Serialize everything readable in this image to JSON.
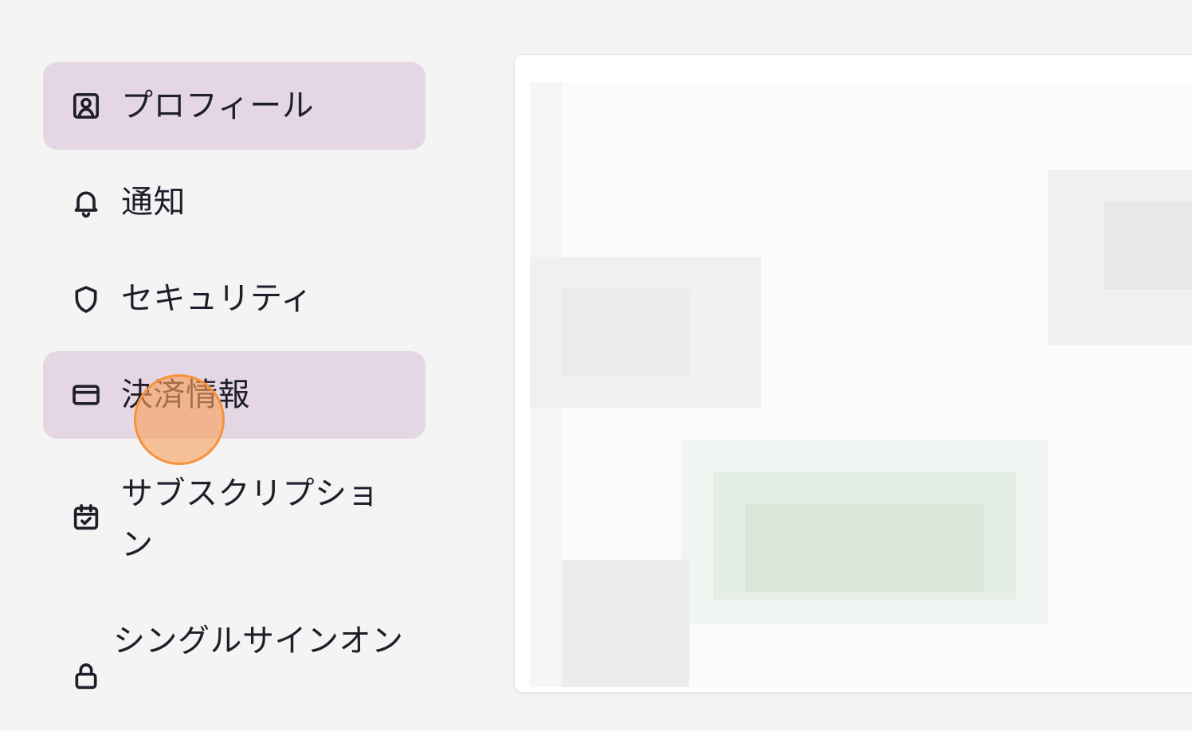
{
  "sidebar": {
    "items": [
      {
        "label": "プロフィール",
        "icon": "profile-icon",
        "active": true
      },
      {
        "label": "通知",
        "icon": "bell-icon",
        "active": false
      },
      {
        "label": "セキュリティ",
        "icon": "shield-icon",
        "active": false
      },
      {
        "label": "決済情報",
        "icon": "credit-card-icon",
        "active": true
      },
      {
        "label": "サブスクリプション",
        "icon": "calendar-check-icon",
        "active": false
      },
      {
        "label": "シングルサインオン",
        "icon": "lock-icon",
        "active": false
      }
    ]
  },
  "colors": {
    "page_background": "#f4f4f4",
    "active_item_background": "#e4d7e3",
    "text": "#1f1f2b",
    "click_indicator": "#f6923c",
    "card_background": "#ffffff"
  }
}
